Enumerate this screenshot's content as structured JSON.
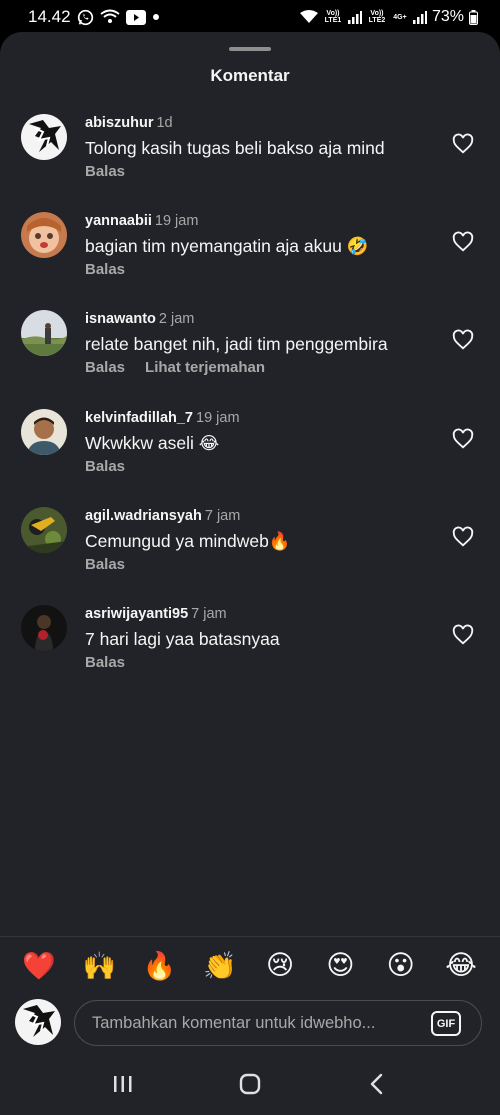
{
  "status_bar": {
    "time": "14.42",
    "battery": "73%",
    "sim1_label": "Vo)) LTE1",
    "sim2_label": "Vo)) LTE2",
    "network": "4G+"
  },
  "sheet": {
    "title": "Komentar"
  },
  "comments": [
    {
      "username": "abiszuhur",
      "time": "1d",
      "text": "Tolong kasih tugas beli bakso aja mind",
      "reply": "Balas",
      "translate": ""
    },
    {
      "username": "yannaabii",
      "time": "19 jam",
      "text": "bagian tim nyemangatin aja akuu 🤣",
      "reply": "Balas",
      "translate": ""
    },
    {
      "username": "isnawanto",
      "time": "2 jam",
      "text": "relate banget nih, jadi tim penggembira",
      "reply": "Balas",
      "translate": "Lihat terjemahan"
    },
    {
      "username": "kelvinfadillah_7",
      "time": "19 jam",
      "text": "Wkwkkw aseli 😂",
      "reply": "Balas",
      "translate": ""
    },
    {
      "username": "agil.wadriansyah",
      "time": "7 jam",
      "text": "Cemungud ya mindweb🔥",
      "reply": "Balas",
      "translate": ""
    },
    {
      "username": "asriwijayanti95",
      "time": "7 jam",
      "text": "7 hari lagi yaa batasnyaa",
      "reply": "Balas",
      "translate": ""
    }
  ],
  "emoji_bar": [
    "❤️",
    "🙌",
    "🔥",
    "👏",
    "😢",
    "😍",
    "😮",
    "😂"
  ],
  "composer": {
    "placeholder": "Tambahkan komentar untuk idwebho...",
    "gif_label": "GIF"
  },
  "colors": {
    "sheet_bg": "#212328",
    "text_primary": "#f5f5f5",
    "text_secondary": "#a8a8a8"
  }
}
